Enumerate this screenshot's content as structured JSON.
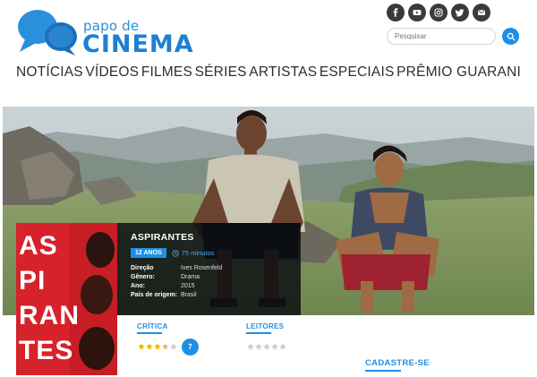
{
  "brand": {
    "small": "papo de",
    "big": "CINEMA",
    "color": "#1f7fd2"
  },
  "social": [
    "facebook-icon",
    "youtube-icon",
    "instagram-icon",
    "twitter-icon",
    "email-icon"
  ],
  "search": {
    "placeholder": "Pesquisar"
  },
  "nav": [
    "NOTÍCIAS",
    "VÍDEOS",
    "FILMES",
    "SÉRIES",
    "ARTISTAS",
    "ESPECIAIS",
    "PRÊMIO GUARANI"
  ],
  "movie": {
    "title": "ASPIRANTES",
    "poster_lines": [
      "AS",
      "PI",
      "RAN",
      "TES"
    ],
    "age_rating": "12 ANOS",
    "duration": "75 minutos",
    "details": [
      {
        "label": "Direção",
        "value": "Ives Rosenfeld"
      },
      {
        "label": "Gênero:",
        "value": "Drama"
      },
      {
        "label": "Ano:",
        "value": "2015"
      },
      {
        "label": "País de origem:",
        "value": "Brasil"
      }
    ]
  },
  "ratings": {
    "critics": {
      "label": "CRÍTICA",
      "stars": 3.5,
      "max": 5,
      "count": "7"
    },
    "readers": {
      "label": "LEITORES",
      "stars": 0,
      "max": 5
    }
  },
  "signup": {
    "label": "CADASTRE-SE"
  },
  "colors": {
    "accent": "#1f8fe6",
    "poster": "#d6222a",
    "star": "#f0b400",
    "star_empty": "#cccccc"
  }
}
